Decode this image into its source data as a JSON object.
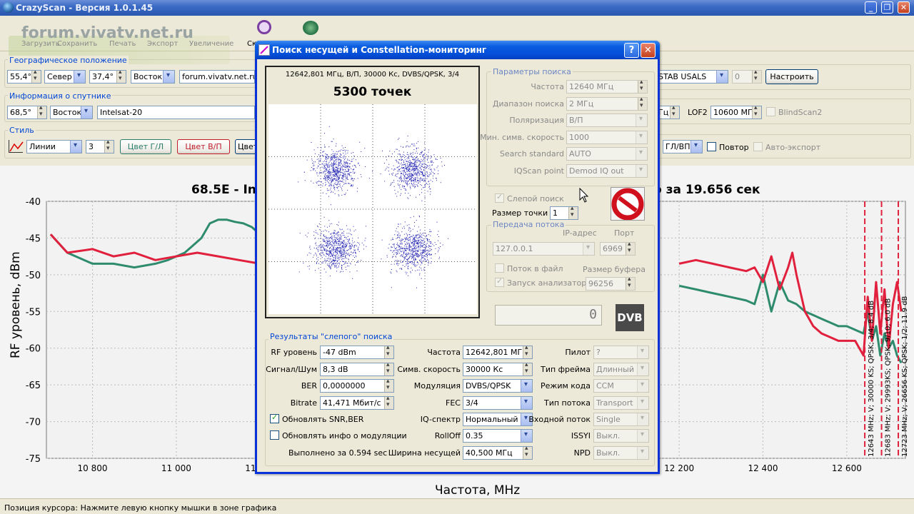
{
  "app": {
    "title": "CrazyScan - Версия 1.0.1.45"
  },
  "toolbar": {
    "watermark": "forum.vivatv.net.ru",
    "buttons": [
      "Загрузить",
      "Сохранить",
      "Печать",
      "Экспорт",
      "Увеличение",
      "Ск"
    ]
  },
  "geo": {
    "label": "Географическое положение",
    "lat": "55,4°",
    "lat_dir": "Север",
    "lon": "37,4°",
    "lon_dir": "Восток",
    "site": "forum.vivatv.net.ru"
  },
  "sat": {
    "label": "Информация о спутнике",
    "pos": "68,5°",
    "dir": "Восток",
    "name": "Intelsat-20"
  },
  "style": {
    "label": "Стиль",
    "line": "Линии",
    "width": "3",
    "color_hl": "Цвет Г/Л",
    "color_vp": "Цвет В/П",
    "color_c": "Цвет"
  },
  "right_panel": {
    "diseqc": "STAB USALS",
    "diseqc_num": "0",
    "setup_btn": "Настроить",
    "lof2_label": "LOF2",
    "lof2": "10600 МГц",
    "blindscan2": "BlindScan2",
    "ghz": "Гц",
    "pol": "ГЛ/ВП",
    "repeat": "Повтор",
    "autoexport": "Авто-экспорт"
  },
  "chart": {
    "title_left": "68.5E - In",
    "title_right": "о за 19.656 сек",
    "ylabel": "RF уровень, dBm",
    "xlabel": "Частота, MHz",
    "yticks": [
      "-40",
      "-45",
      "-50",
      "-55",
      "-60",
      "-65",
      "-70",
      "-75"
    ],
    "xticks": [
      "10 800",
      "11 000",
      "11 200",
      "11 400",
      "11 600",
      "11 800",
      "12 000",
      "12 200",
      "12 400",
      "12 600"
    ],
    "markers": [
      "12643 MHz; V; 30000 KS; QPSK; 3/4; 8.4 dB",
      "12683 MHz; V; 29993KS; QPSK; 9/10; 6.0 dB",
      "12723 MHz; V; 26656 KS; QPSK; 1/2; 11.9 dB"
    ]
  },
  "chart_data": {
    "type": "line",
    "xlim": [
      10690,
      12740
    ],
    "ylim": [
      -75,
      -40
    ],
    "series": [
      {
        "color": "#2E8B6E",
        "x": [
          10700,
          10740,
          10800,
          10850,
          10900,
          10950,
          10980,
          11000,
          11020,
          11040,
          11060,
          11080,
          11100,
          11120,
          11140,
          11160,
          11180,
          11200,
          12200,
          12240,
          12280,
          12320,
          12360,
          12380,
          12400,
          12420,
          12440,
          12460,
          12480,
          12500,
          12520,
          12540,
          12560,
          12580,
          12600,
          12620,
          12640,
          12650,
          12660,
          12670,
          12680,
          12690,
          12700,
          12710,
          12720,
          12730
        ],
        "y": [
          -44.5,
          -47,
          -48.5,
          -48.5,
          -49,
          -48.5,
          -48,
          -47.5,
          -47,
          -46,
          -45,
          -43,
          -42.5,
          -42.5,
          -42.8,
          -43,
          -43.5,
          -44.5,
          -51.5,
          -52,
          -52.5,
          -53,
          -53.5,
          -54,
          -50,
          -55,
          -51,
          -53.5,
          -54,
          -55,
          -55.5,
          -56,
          -56.5,
          -57,
          -57,
          -57.5,
          -58,
          -55,
          -59,
          -57,
          -61,
          -58,
          -60,
          -59,
          -61,
          -62
        ]
      },
      {
        "color": "#E0203C",
        "x": [
          10700,
          10740,
          10800,
          10850,
          10900,
          10950,
          11000,
          11050,
          11100,
          11150,
          11200,
          12200,
          12240,
          12280,
          12320,
          12360,
          12380,
          12400,
          12420,
          12440,
          12460,
          12470,
          12480,
          12500,
          12520,
          12540,
          12560,
          12580,
          12600,
          12620,
          12630,
          12640,
          12650,
          12660,
          12670,
          12680,
          12690,
          12700,
          12710,
          12720,
          12730
        ],
        "y": [
          -44.5,
          -47,
          -46.5,
          -47.5,
          -47,
          -48,
          -47.5,
          -47,
          -47.5,
          -48,
          -48.5,
          -48.5,
          -48,
          -48.5,
          -49,
          -49.5,
          -49,
          -51,
          -47.5,
          -52,
          -49,
          -47,
          -50,
          -55,
          -57,
          -58,
          -58.5,
          -59,
          -59,
          -59,
          -60,
          -61,
          -53,
          -59,
          -51,
          -58,
          -52,
          -60,
          -54,
          -51,
          -55
        ]
      }
    ],
    "markers_x": [
      12643,
      12683,
      12723
    ]
  },
  "dialog": {
    "title": "Поиск несущей и Constellation-мониторинг",
    "const_header": "12642,801 МГц, В/П, 30000 Кс, DVBS/QPSK, 3/4",
    "points": "5300 точек",
    "search_params": {
      "label": "Параметры поиска",
      "freq_label": "Частота",
      "freq": "12640 МГц",
      "range_label": "Диапазон поиска",
      "range": "2 МГц",
      "pol_label": "Поляризация",
      "pol": "В/П",
      "minsr_label": "Мин. симв. скорость",
      "minsr": "1000",
      "std_label": "Search standard",
      "std": "AUTO",
      "iq_label": "IQScan point",
      "iq": "Demod IQ out"
    },
    "blind_label": "Слепой поиск",
    "dot_size_label": "Размер точки",
    "dot_size": "1",
    "stream": {
      "label": "Передача потока",
      "ip_label": "IP-адрес",
      "port_label": "Порт",
      "ip": "127.0.0.1",
      "port": "6969",
      "tofile": "Поток в файл",
      "buf_label": "Размер буфера",
      "analyzer": "Запуск анализатора",
      "buf": "96256"
    },
    "counter": "0",
    "dvb": "DVB",
    "results": {
      "label": "Результаты \"слепого\" поиска",
      "rf_label": "RF уровень",
      "rf": "-47 dBm",
      "snr_label": "Сигнал/Шум",
      "snr": "8,3 dB",
      "ber_label": "BER",
      "ber": "0,0000000",
      "bitrate_label": "Bitrate",
      "bitrate": "41,471 Мбит/c",
      "upd_snr": "Обновлять SNR,BER",
      "upd_mod": "Обновлять инфо о модуляции",
      "done": "Выполнено за 0.594 sec",
      "freq_label": "Частота",
      "freq": "12642,801 МГц",
      "sr_label": "Симв. скорость",
      "sr": "30000 Кс",
      "mod_label": "Модуляция",
      "mod": "DVBS/QPSK",
      "fec_label": "FEC",
      "fec": "3/4",
      "iqs_label": "IQ-спектр",
      "iqs": "Нормальный",
      "roll_label": "RollOff",
      "roll": "0.35",
      "bw_label": "Ширина несущей",
      "bw": "40,500 МГц",
      "pilot_label": "Пилот",
      "pilot": "?",
      "frame_label": "Тип фрейма",
      "frame": "Длинный",
      "code_label": "Режим кода",
      "code": "CCM",
      "stype_label": "Тип потока",
      "stype": "Transport",
      "input_label": "Входной поток",
      "input": "Single",
      "issyi_label": "ISSYI",
      "issyi": "Выкл.",
      "npd_label": "NPD",
      "npd": "Выкл."
    }
  },
  "status": {
    "text": "Позиция курсора: Нажмите левую кнопку мышки в зоне графика"
  }
}
